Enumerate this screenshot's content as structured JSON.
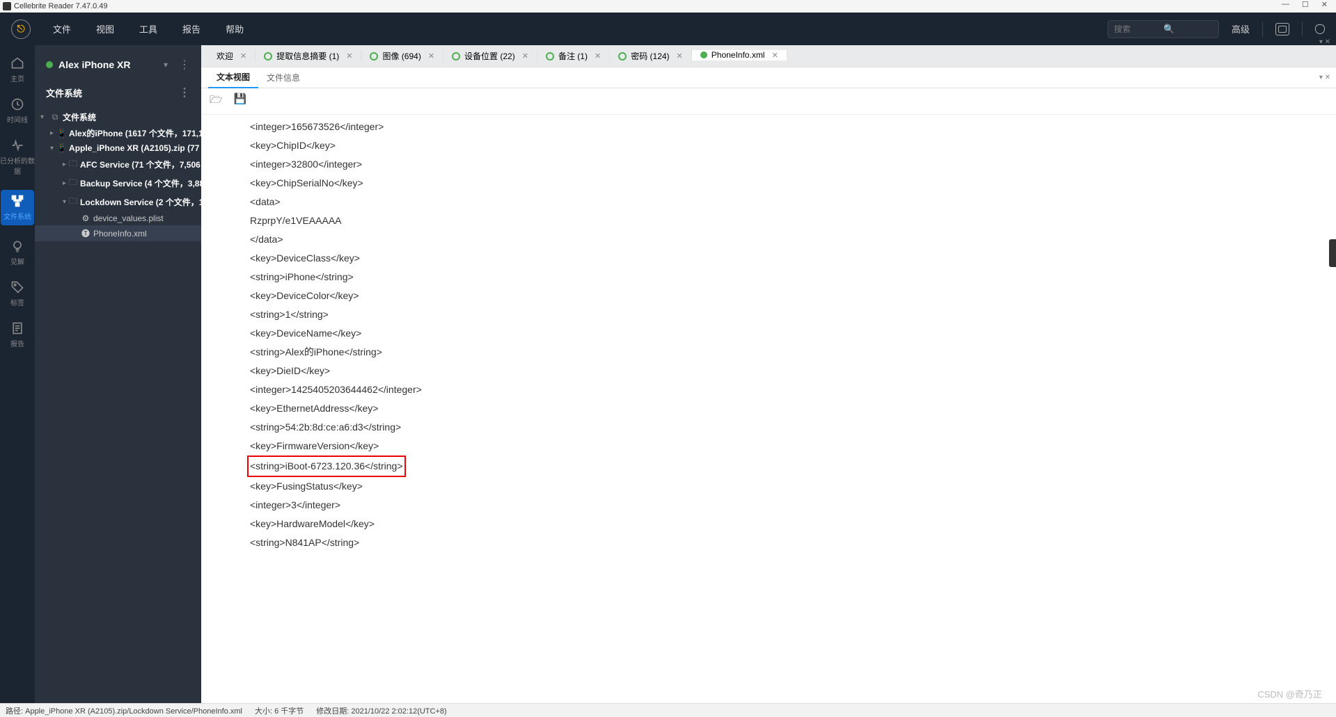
{
  "title_bar": "Cellebrite Reader 7.47.0.49",
  "menu": [
    "文件",
    "视图",
    "工具",
    "报告",
    "帮助"
  ],
  "search_placeholder": "搜索",
  "advanced": "高级",
  "rail": [
    {
      "name": "home",
      "label": "主页"
    },
    {
      "name": "timeline",
      "label": "时间线"
    },
    {
      "name": "analyzed",
      "label": "已分析的数据"
    },
    {
      "name": "fs",
      "label": "文件系统"
    },
    {
      "name": "insights",
      "label": "见解"
    },
    {
      "name": "tags",
      "label": "标签"
    },
    {
      "name": "report",
      "label": "报告"
    }
  ],
  "device": {
    "name": "Alex iPhone XR"
  },
  "fs_title": "文件系统",
  "tree": {
    "root": "文件系统",
    "node1": "Alex的iPhone  (1617 个文件，171,1",
    "node2": "Apple_iPhone XR (A2105).zip  (77",
    "afc": "AFC Service  (71 个文件，7,506",
    "backup": "Backup Service  (4 个文件，3,88",
    "lockdown": "Lockdown Service  (2 个文件，1",
    "file1": "device_values.plist",
    "file2": "PhoneInfo.xml"
  },
  "tabs": [
    {
      "label": "欢迎",
      "kind": "none"
    },
    {
      "label": "提取信息摘要 (1)",
      "kind": "open"
    },
    {
      "label": "图像 (694)",
      "kind": "open"
    },
    {
      "label": "设备位置 (22)",
      "kind": "open"
    },
    {
      "label": "备注 (1)",
      "kind": "open"
    },
    {
      "label": "密码 (124)",
      "kind": "open"
    },
    {
      "label": "PhoneInfo.xml",
      "kind": "filled",
      "active": true
    }
  ],
  "sub_tabs": {
    "a": "文本视图",
    "b": "文件信息"
  },
  "xml_lines": [
    "<integer>165673526</integer>",
    "<key>ChipID</key>",
    "<integer>32800</integer>",
    "<key>ChipSerialNo</key>",
    "<data>",
    "RzprpY/e1VEAAAAA",
    "</data>",
    "<key>DeviceClass</key>",
    "<string>iPhone</string>",
    "<key>DeviceColor</key>",
    "<string>1</string>",
    "<key>DeviceName</key>",
    "<string>Alex的iPhone</string>",
    "<key>DieID</key>",
    "<integer>1425405203644462</integer>",
    "<key>EthernetAddress</key>",
    "<string>54:2b:8d:ce:a6:d3</string>",
    "<key>FirmwareVersion</key>",
    "<string>iBoot-6723.120.36</string>",
    "<key>FusingStatus</key>",
    "<integer>3</integer>",
    "<key>HardwareModel</key>",
    "<string>N841AP</string>"
  ],
  "highlight_index": 18,
  "status": {
    "path": "路径: Apple_iPhone XR (A2105).zip/Lockdown Service/PhoneInfo.xml",
    "size": "大小: 6 千字节",
    "mdate": "修改日期: 2021/10/22 2:02:12(UTC+8)"
  },
  "watermark": "CSDN @奇乃正"
}
